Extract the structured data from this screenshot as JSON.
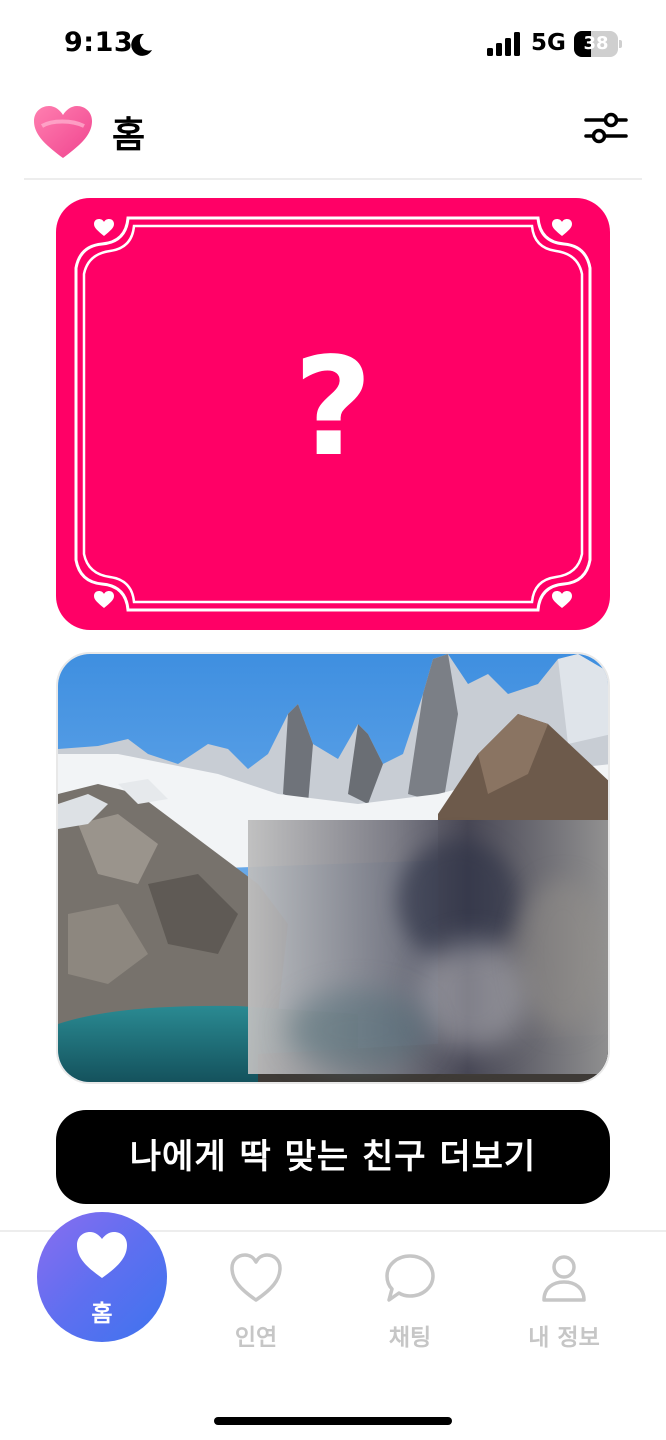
{
  "status_bar": {
    "time": "9:13",
    "network": "5G",
    "battery": "38",
    "battery_level_percent": 38,
    "icons": [
      "moon-icon",
      "signal-icon",
      "battery-icon"
    ]
  },
  "header": {
    "title": "홈",
    "logo_icon": "heart-icon",
    "filter_icon": "sliders-icon"
  },
  "mystery_card": {
    "symbol": "?",
    "color": "#ff0066",
    "icons": [
      "small-heart-icon"
    ]
  },
  "profile_card": {
    "image": "mountain-lake-photo",
    "blurred": true
  },
  "more_button": {
    "label": "나에게 딱 맞는 친구 더보기"
  },
  "tab_bar": {
    "tabs": [
      {
        "label": "홈",
        "icon": "heart-icon",
        "active": true
      },
      {
        "label": "인연",
        "icon": "heart-outline-icon",
        "active": false
      },
      {
        "label": "채팅",
        "icon": "chat-bubble-icon",
        "active": false
      },
      {
        "label": "내 정보",
        "icon": "person-icon",
        "active": false
      }
    ]
  },
  "colors": {
    "accent": "#ff0066",
    "tab_active_gradient": [
      "#8a6df0",
      "#3d74ee"
    ],
    "tab_inactive": "#c6c6c6",
    "button": "#000000"
  }
}
